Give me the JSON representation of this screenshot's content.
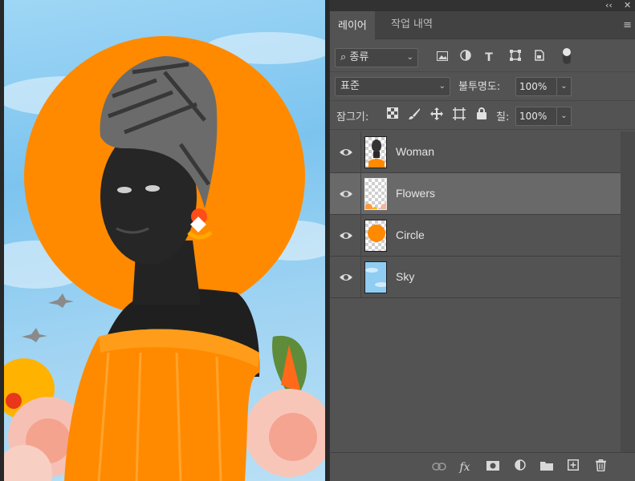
{
  "panel": {
    "topbar": {
      "collapse_glyph": "‹‹",
      "close_glyph": "✕"
    },
    "tabs": [
      {
        "label": "레이어",
        "active": true
      },
      {
        "label": "작업 내역",
        "active": false
      }
    ],
    "menu_glyph": "≡",
    "filter": {
      "kind_label": "종류",
      "icons": [
        "image-filter-icon",
        "adjustment-filter-icon",
        "type-filter-icon",
        "shape-filter-icon",
        "smart-object-filter-icon",
        "filter-toggle-icon"
      ]
    },
    "blend": {
      "mode": "표준",
      "opacity_label": "불투명도:",
      "opacity_value": "100%"
    },
    "lock": {
      "label": "잠그기:",
      "icons": [
        "lock-transparent-icon",
        "lock-paint-icon",
        "lock-position-icon",
        "lock-artboard-icon",
        "lock-all-icon"
      ],
      "fill_label": "칠:",
      "fill_value": "100%"
    },
    "layers": [
      {
        "name": "Woman",
        "visible": true,
        "selected": false,
        "thumb": "woman"
      },
      {
        "name": "Flowers",
        "visible": true,
        "selected": true,
        "thumb": "flowers"
      },
      {
        "name": "Circle",
        "visible": true,
        "selected": false,
        "thumb": "circle"
      },
      {
        "name": "Sky",
        "visible": true,
        "selected": false,
        "thumb": "sky"
      }
    ],
    "footer_icons": [
      "link-layers-icon",
      "fx-icon",
      "mask-icon",
      "adjustment-layer-icon",
      "group-folder-icon",
      "new-layer-icon",
      "trash-icon"
    ],
    "footer_fx_label": "fx"
  },
  "colors": {
    "panel_bg": "#535353",
    "selected_row": "#696969",
    "sun_orange": "#ff8a00",
    "sky_blue": "#8fcdf2"
  }
}
